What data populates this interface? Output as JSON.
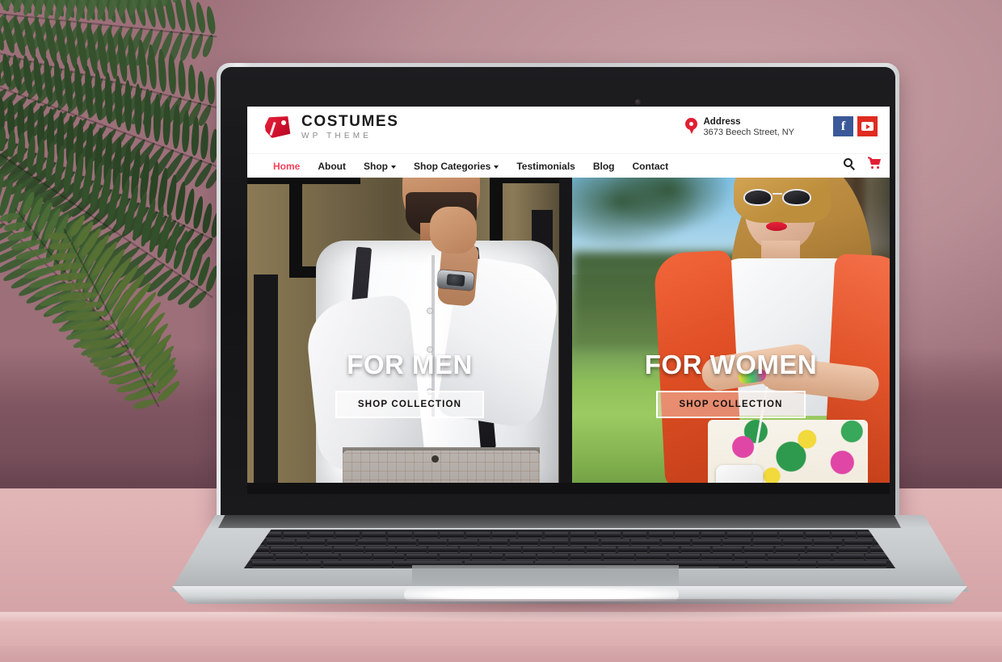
{
  "site": {
    "logo": {
      "name": "COSTUMES",
      "tagline": "WP THEME",
      "icon": "price-tag-icon"
    },
    "contact": {
      "icon": "location-pin-icon",
      "label": "Address",
      "value": "3673 Beech Street, NY"
    },
    "socials": [
      {
        "name": "facebook",
        "glyph": "f",
        "color": "#3b5998"
      },
      {
        "name": "youtube",
        "glyph": "▶",
        "color": "#e02b20"
      }
    ],
    "nav": {
      "items": [
        {
          "label": "Home",
          "active": true,
          "caret": false
        },
        {
          "label": "About",
          "active": false,
          "caret": false
        },
        {
          "label": "Shop",
          "active": false,
          "caret": true
        },
        {
          "label": "Shop Categories",
          "active": false,
          "caret": true
        },
        {
          "label": "Testimonials",
          "active": false,
          "caret": false
        },
        {
          "label": "Blog",
          "active": false,
          "caret": false
        },
        {
          "label": "Contact",
          "active": false,
          "caret": false
        }
      ],
      "active_color": "#f2415a",
      "search_icon": "search-icon",
      "cart_icon": "shopping-cart-icon"
    },
    "hero": {
      "panels": [
        {
          "title": "FOR MEN",
          "button": "SHOP COLLECTION"
        },
        {
          "title": "FOR WOMEN",
          "button": "SHOP COLLECTION"
        }
      ]
    }
  },
  "scene": {
    "device": "laptop",
    "colors": {
      "wall": "#b78d95",
      "wall_shadow": "#7e5560",
      "counter": "#dcaeb0",
      "plant": "#2f4a2c",
      "laptop_body": "#cfd2d4",
      "bezel": "#17171a"
    }
  }
}
